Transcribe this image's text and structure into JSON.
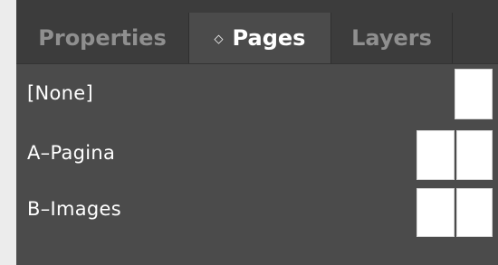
{
  "tabs": {
    "properties": "Properties",
    "pages": "Pages",
    "pages_indicator": "◇",
    "layers": "Layers"
  },
  "masters": [
    {
      "label": "[None]",
      "spread": "single"
    },
    {
      "label": "A–Pagina",
      "spread": "facing"
    },
    {
      "label": "B–Images",
      "spread": "facing"
    }
  ],
  "colors": {
    "panel_bg": "#4b4b4b",
    "tab_inactive_text": "#8f8f8f",
    "tab_active_text": "#ffffff",
    "page_thumb": "#ffffff"
  }
}
